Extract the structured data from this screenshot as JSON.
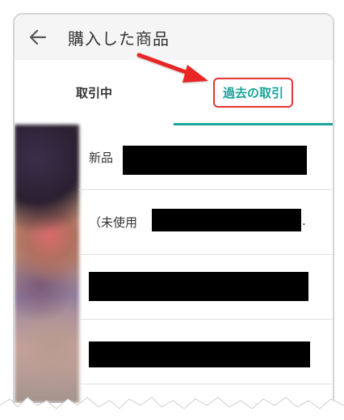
{
  "appbar": {
    "title": "購入した商品",
    "back_icon": "arrow-left-icon"
  },
  "tabs": [
    {
      "label": "取引中",
      "selected": false
    },
    {
      "label": "過去の取引",
      "selected": true,
      "highlighted": true
    }
  ],
  "items": [
    {
      "text": "新品",
      "redacted": true
    },
    {
      "text": "（未使用",
      "suffix": ".",
      "redacted": true
    },
    {
      "text": "",
      "redacted": true
    },
    {
      "text": "",
      "redacted": true
    }
  ],
  "colors": {
    "accent": "#1aa39a",
    "annotation": "#e53535",
    "appbar_bg": "#f5f5f5"
  }
}
